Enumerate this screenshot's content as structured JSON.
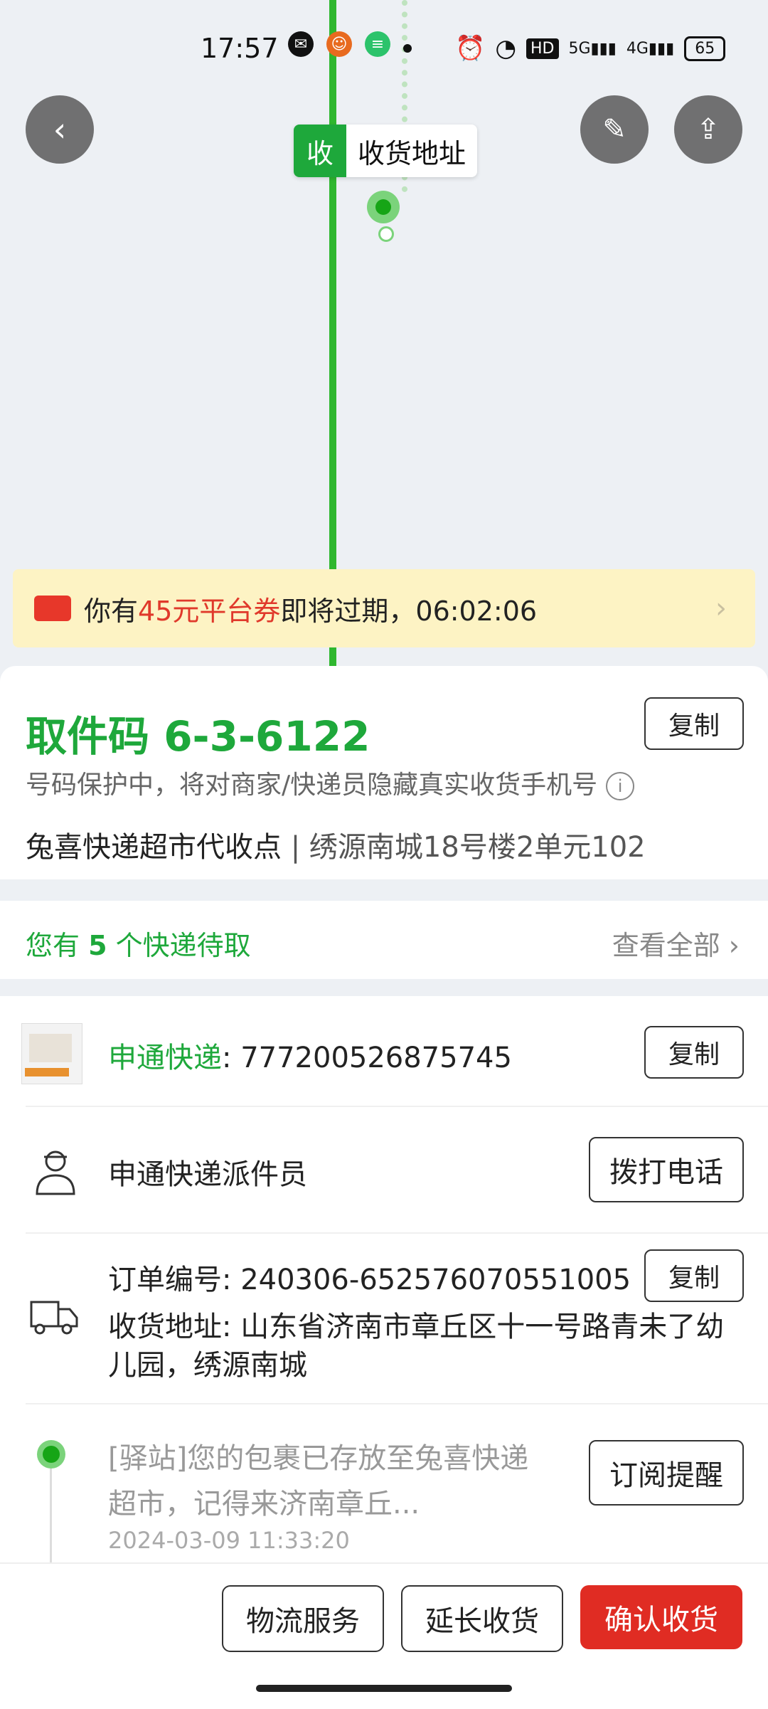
{
  "status_bar": {
    "time": "17:57",
    "network_labels": [
      "5G",
      "4G"
    ],
    "battery": "65"
  },
  "map": {
    "marker_tag": "收",
    "marker_text": "收货地址"
  },
  "coupon": {
    "prefix": "你有",
    "highlight": "45元平台券",
    "suffix": "即将过期，",
    "countdown": "06:02:06"
  },
  "pickup": {
    "code_label": "取件码 6-3-6122",
    "copy_label": "复制",
    "protect_note": "号码保护中，将对商家/快递员隐藏真实收货手机号",
    "station_name": "兔喜快递超市代收点",
    "separator": "|",
    "station_address": "绣源南城18号楼2单元102"
  },
  "pending": {
    "prefix": "您有",
    "count": "5",
    "suffix": "个快递待取",
    "view_all": "查看全部"
  },
  "shipment": {
    "carrier": "申通快递",
    "tracking_number": ": 777200526875745",
    "copy_label": "复制",
    "courier_label": "申通快递派件员",
    "call_label": "拨打电话",
    "order_label": "订单编号: 240306-652576070551005",
    "order_copy_label": "复制",
    "address_label": "收货地址: 山东省济南市章丘区十一号路青未了幼儿园，绣源南城",
    "tracking_text": "[驿站]您的包裹已存放至兔喜快递超市，记得来济南章丘...",
    "tracking_time": "2024-03-09 11:33:20",
    "subscribe_label": "订阅提醒"
  },
  "bottom_bar": {
    "logistics": "物流服务",
    "extend": "延长收货",
    "confirm": "确认收货"
  },
  "colors": {
    "accent_green": "#1ea83b",
    "confirm_red": "#e02c23",
    "coupon_bg": "#fdf3c4"
  }
}
